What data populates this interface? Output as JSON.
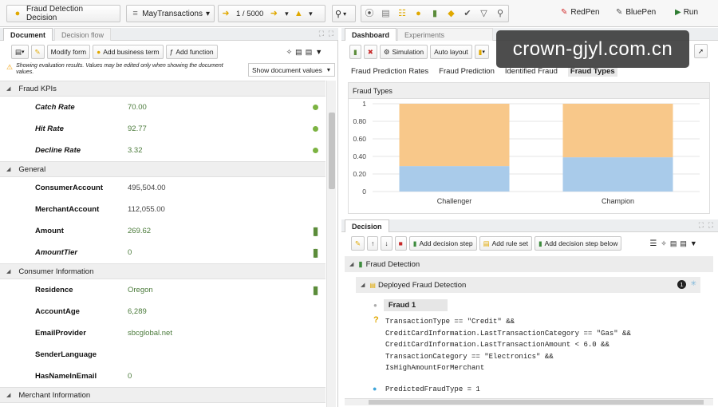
{
  "toolbar": {
    "decision_title": "Fraud Detection Decision",
    "dataset": "MayTransactions",
    "pager": "1 / 5000",
    "redpen": "RedPen",
    "bluepen": "BluePen",
    "run": "Run"
  },
  "left_panel": {
    "tabs": [
      "Document",
      "Decision flow"
    ],
    "actions": {
      "modify_form": "Modify form",
      "add_business_term": "Add business term",
      "add_function": "Add function"
    },
    "notice": "Showing evaluation results. Values may be edited only when showing the document values.",
    "show_values_select": "Show document values",
    "sections": [
      {
        "title": "Fraud KPIs",
        "fields": [
          {
            "label": "Catch Rate",
            "value": "70.00",
            "italic": true,
            "marker": "dot"
          },
          {
            "label": "Hit Rate",
            "value": "92.77",
            "italic": true,
            "marker": "dot"
          },
          {
            "label": "Decline Rate",
            "value": "3.32",
            "italic": true,
            "marker": "dot"
          }
        ]
      },
      {
        "title": "General",
        "fields": [
          {
            "label": "ConsumerAccount",
            "value": "495,504.00",
            "italic": false,
            "marker": "",
            "dark": true
          },
          {
            "label": "MerchantAccount",
            "value": "112,055.00",
            "italic": false,
            "marker": "",
            "dark": true
          },
          {
            "label": "Amount",
            "value": "269.62",
            "italic": false,
            "marker": "bars"
          },
          {
            "label": "AmountTier",
            "value": "0",
            "italic": true,
            "marker": "bars"
          }
        ]
      },
      {
        "title": "Consumer Information",
        "fields": [
          {
            "label": "Residence",
            "value": "Oregon",
            "italic": false,
            "marker": "bars"
          },
          {
            "label": "AccountAge",
            "value": "6,289",
            "italic": false,
            "marker": ""
          },
          {
            "label": "EmailProvider",
            "value": "sbcglobal.net",
            "italic": false,
            "marker": ""
          },
          {
            "label": "SenderLanguage",
            "value": "",
            "italic": false,
            "marker": ""
          },
          {
            "label": "HasNameInEmail",
            "value": "0",
            "italic": false,
            "marker": ""
          }
        ]
      },
      {
        "title": "Merchant Information",
        "fields": []
      }
    ]
  },
  "dashboard": {
    "tabs": [
      "Dashboard",
      "Experiments"
    ],
    "actions": {
      "simulation": "Simulation",
      "auto_layout": "Auto layout"
    },
    "subtabs": [
      "Fraud Prediction Rates",
      "Fraud Prediction",
      "Identified Fraud",
      "Fraud Types"
    ],
    "chart_panel_title": "Fraud Types"
  },
  "chart_data": {
    "type": "bar",
    "stacked": true,
    "categories": [
      "Challenger",
      "Champion"
    ],
    "series": [
      {
        "name": "",
        "color": "#a9cbea",
        "values": [
          0.29,
          0.39
        ]
      },
      {
        "name": "",
        "color": "#f8c88a",
        "values": [
          0.71,
          0.61
        ]
      }
    ],
    "yticks": [
      "1",
      "0.80",
      "0.60",
      "0.40",
      "0.20",
      "0"
    ],
    "ylim": [
      0,
      1
    ],
    "grid": true
  },
  "decision": {
    "tab": "Decision",
    "actions": {
      "add_decision_step": "Add decision step",
      "add_rule_set": "Add rule set",
      "add_decision_step_below": "Add decision step below"
    },
    "root": "Fraud Detection",
    "child": "Deployed Fraud Detection",
    "badge": "1",
    "rule": "Fraud 1",
    "condition_lines": [
      "TransactionType == \"Credit\" &&",
      "CreditCardInformation.LastTransactionCategory == \"Gas\" &&",
      "CreditCardInformation.LastTransactionAmount < 6.0 &&",
      "TransactionCategory == \"Electronics\" &&",
      "IsHighAmountForMerchant"
    ],
    "action": "PredictedFraudType = 1"
  },
  "watermark": "crown-gjyl.com.cn",
  "colors": {
    "green": "#4a7a3a",
    "orange": "#f8c88a",
    "blue": "#a9cbea",
    "watermark_bg": "#3a3a3a"
  }
}
